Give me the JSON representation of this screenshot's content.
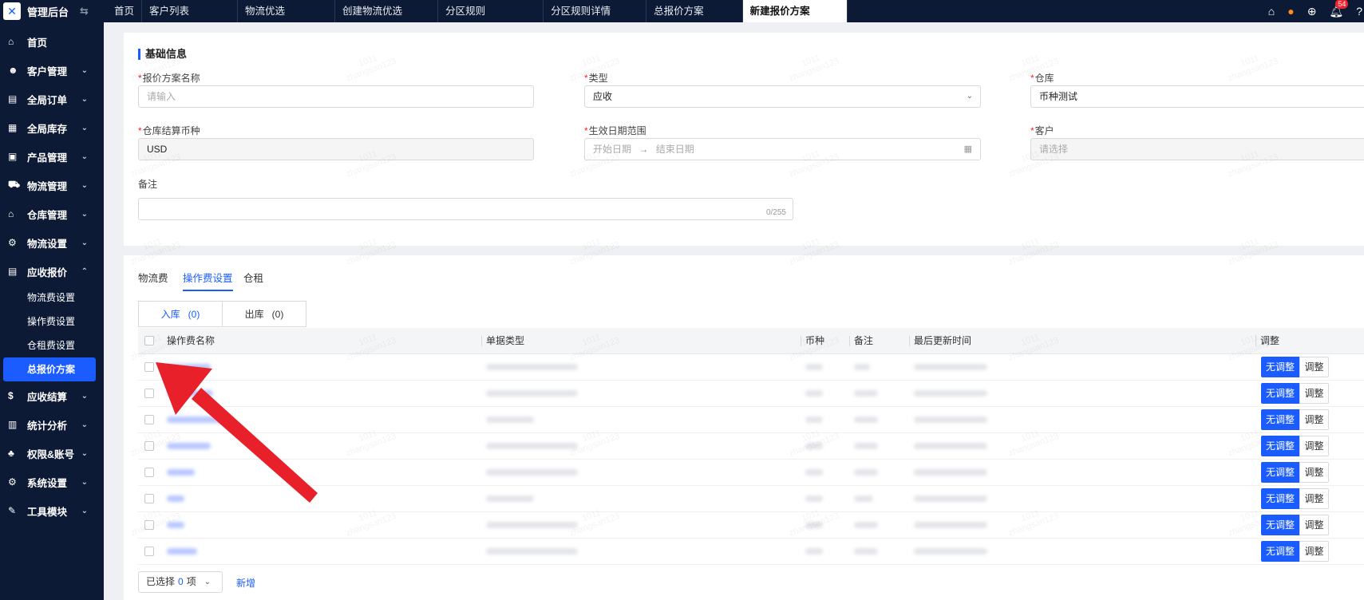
{
  "app": {
    "title": "管理后台"
  },
  "tabs": [
    "首页",
    "客户列表",
    "物流优选",
    "创建物流优选",
    "分区规则",
    "分区规则详情",
    "总报价方案",
    "新建报价方案"
  ],
  "notifications": {
    "count": "54"
  },
  "sidebar": {
    "items": [
      {
        "label": "首页",
        "icon": "home-icon"
      },
      {
        "label": "客户管理",
        "icon": "user-icon"
      },
      {
        "label": "全局订单",
        "icon": "order-icon"
      },
      {
        "label": "全局库存",
        "icon": "inventory-icon"
      },
      {
        "label": "产品管理",
        "icon": "product-icon"
      },
      {
        "label": "物流管理",
        "icon": "truck-icon"
      },
      {
        "label": "仓库管理",
        "icon": "warehouse-icon"
      },
      {
        "label": "物流设置",
        "icon": "settings-icon"
      },
      {
        "label": "应收报价",
        "icon": "document-icon"
      }
    ],
    "subitems": [
      "物流费设置",
      "操作费设置",
      "仓租费设置",
      "总报价方案"
    ],
    "items_after": [
      {
        "label": "应收结算",
        "icon": "dollar-icon"
      },
      {
        "label": "统计分析",
        "icon": "chart-icon"
      },
      {
        "label": "权限&账号",
        "icon": "org-icon"
      },
      {
        "label": "系统设置",
        "icon": "gear-icon"
      },
      {
        "label": "工具模块",
        "icon": "wrench-icon"
      }
    ]
  },
  "basic": {
    "section_title": "基础信息",
    "plan_name": {
      "label": "报价方案名称",
      "placeholder": "请输入"
    },
    "type": {
      "label": "类型",
      "value": "应收"
    },
    "warehouse": {
      "label": "仓库",
      "value": "币种测试"
    },
    "currency": {
      "label": "仓库结算币种",
      "value": "USD"
    },
    "date_range": {
      "label": "生效日期范围",
      "start": "开始日期",
      "arrow": "→",
      "end": "结束日期"
    },
    "customer": {
      "label": "客户",
      "placeholder": "请选择"
    },
    "remark": {
      "label": "备注",
      "counter": "0/255"
    }
  },
  "fee_tabs": [
    "物流费",
    "操作费设置",
    "仓租"
  ],
  "segments": [
    {
      "label": "入库",
      "count": "(0)"
    },
    {
      "label": "出库",
      "count": "(0)"
    }
  ],
  "table": {
    "headers": [
      "操作费名称",
      "单据类型",
      "币种",
      "备注",
      "最后更新时间",
      "调整"
    ],
    "row_buttons": {
      "primary": "无调整",
      "secondary": "调整"
    },
    "row_count": 8
  },
  "footer": {
    "selected_prefix": "已选择",
    "selected_count": "0",
    "selected_suffix": "项",
    "add_label": "新增"
  },
  "watermark": {
    "line1": "1011",
    "line2": "zhangsan123"
  },
  "colors": {
    "primary": "#1a5cff",
    "sidebar": "#0d1a35",
    "arrow": "#e8202a"
  }
}
